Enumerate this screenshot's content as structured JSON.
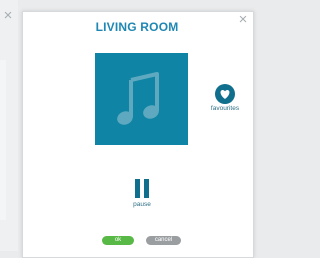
{
  "dialog": {
    "title": "LIVING ROOM",
    "close_glyph": "×",
    "album_art_icon": "music-note-icon"
  },
  "background": {
    "close_glyph": "×"
  },
  "actions": {
    "favourites_label": "favourites",
    "favourites_icon": "heart-icon",
    "pause_label": "pause",
    "pause_icon": "pause-icon"
  },
  "buttons": {
    "ok_label": "ok",
    "cancel_label": "cancel"
  },
  "colors": {
    "accent": "#1f87b4",
    "art_background": "#0f84a4",
    "icon_dark": "#0f6f8c",
    "ok_green": "#59b947",
    "cancel_gray": "#9a9ea1"
  }
}
